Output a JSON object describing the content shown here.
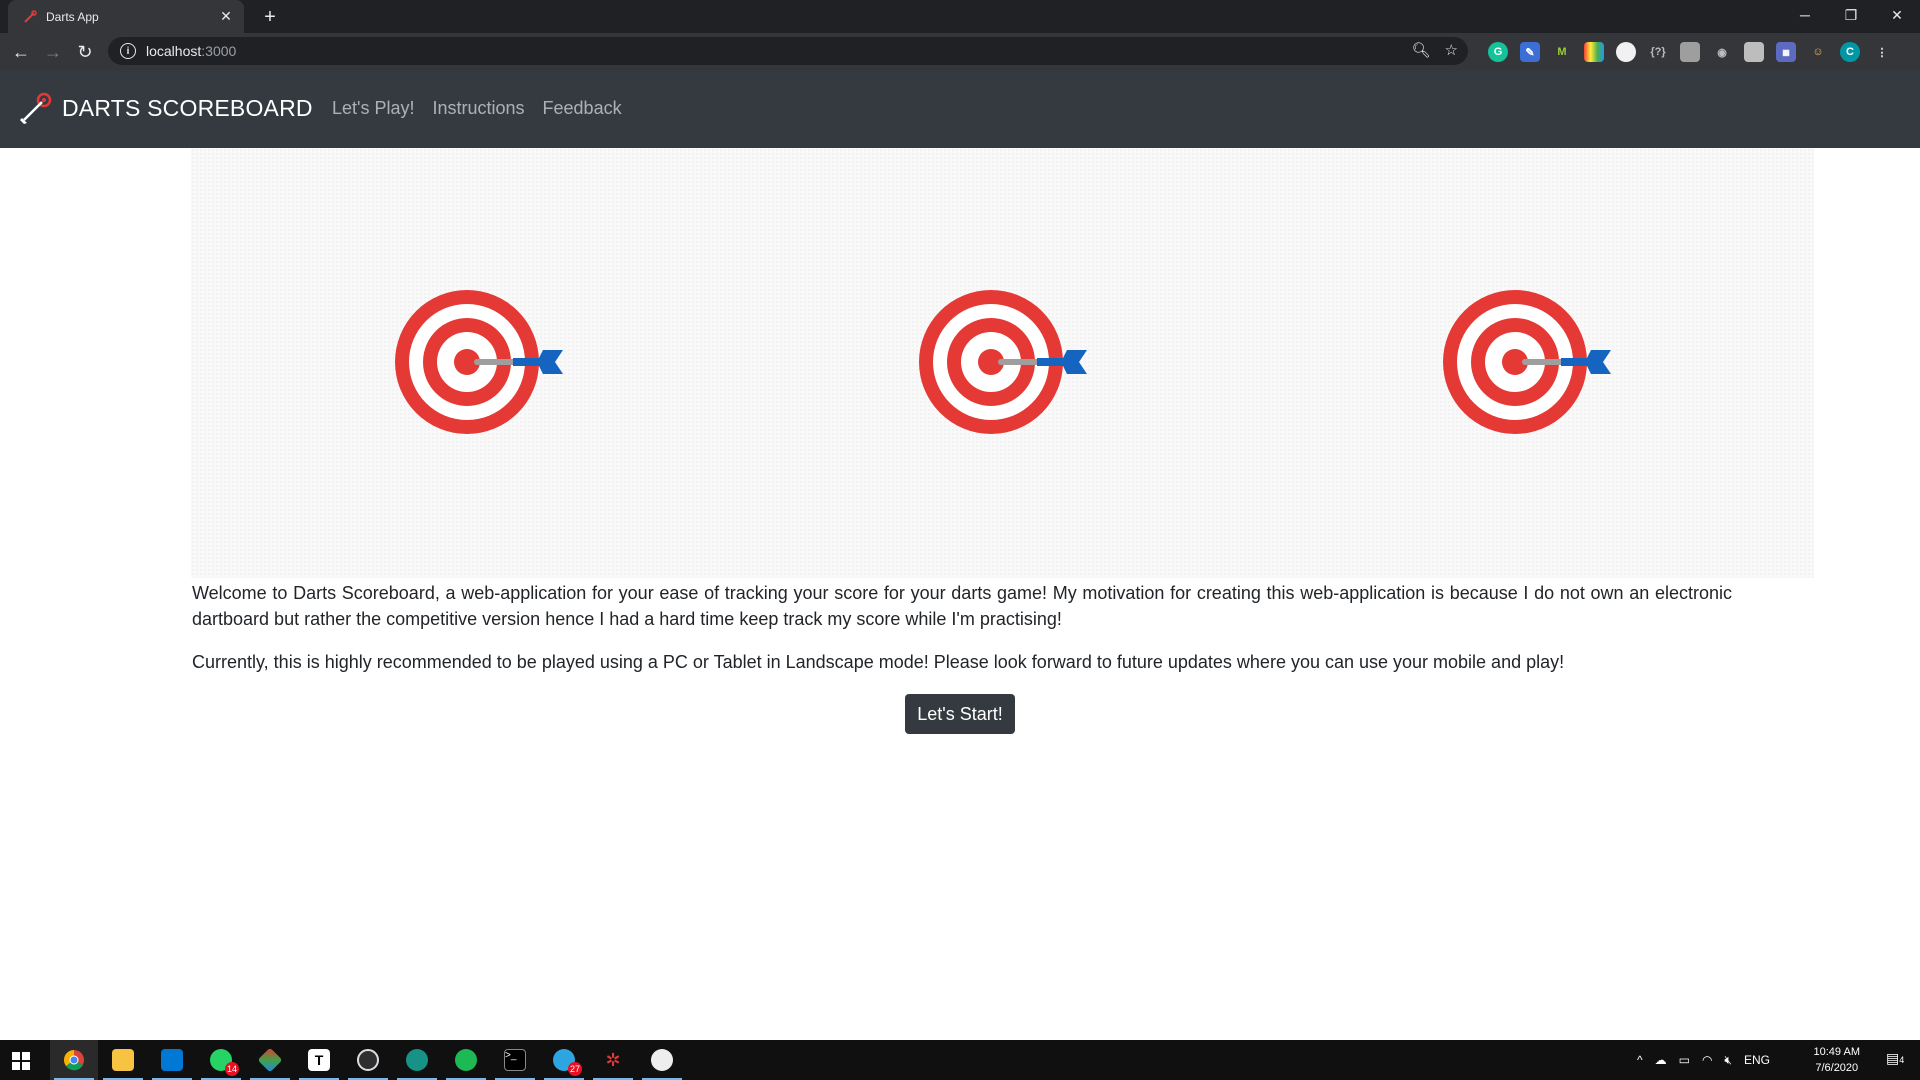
{
  "browser": {
    "tab_title": "Darts App",
    "url_host": "localhost",
    "url_port": ":3000"
  },
  "navbar": {
    "brand": "DARTS SCOREBOARD",
    "links": [
      "Let's Play!",
      "Instructions",
      "Feedback"
    ]
  },
  "content": {
    "paragraph1": "Welcome to Darts Scoreboard, a web-application for your ease of tracking your score for your darts game! My motivation for creating this web-application is because I do not own an electronic dartboard but rather the competitive version hence I had a hard time keep track my score while I'm practising!",
    "paragraph2": "Currently, this is highly recommended to be played using a PC or Tablet in Landscape mode! Please look forward to future updates where you can use your mobile and play!",
    "start_button": "Let's Start!"
  },
  "taskbar": {
    "badges": {
      "whatsapp": "14",
      "telegram": "27"
    },
    "tray_lang": "ENG",
    "time": "10:49 AM",
    "date": "7/6/2020",
    "notifications": "4"
  },
  "colors": {
    "navbar": "#343a40",
    "target_red": "#e53935",
    "dart_blue": "#1565c0",
    "button": "#343a40"
  }
}
